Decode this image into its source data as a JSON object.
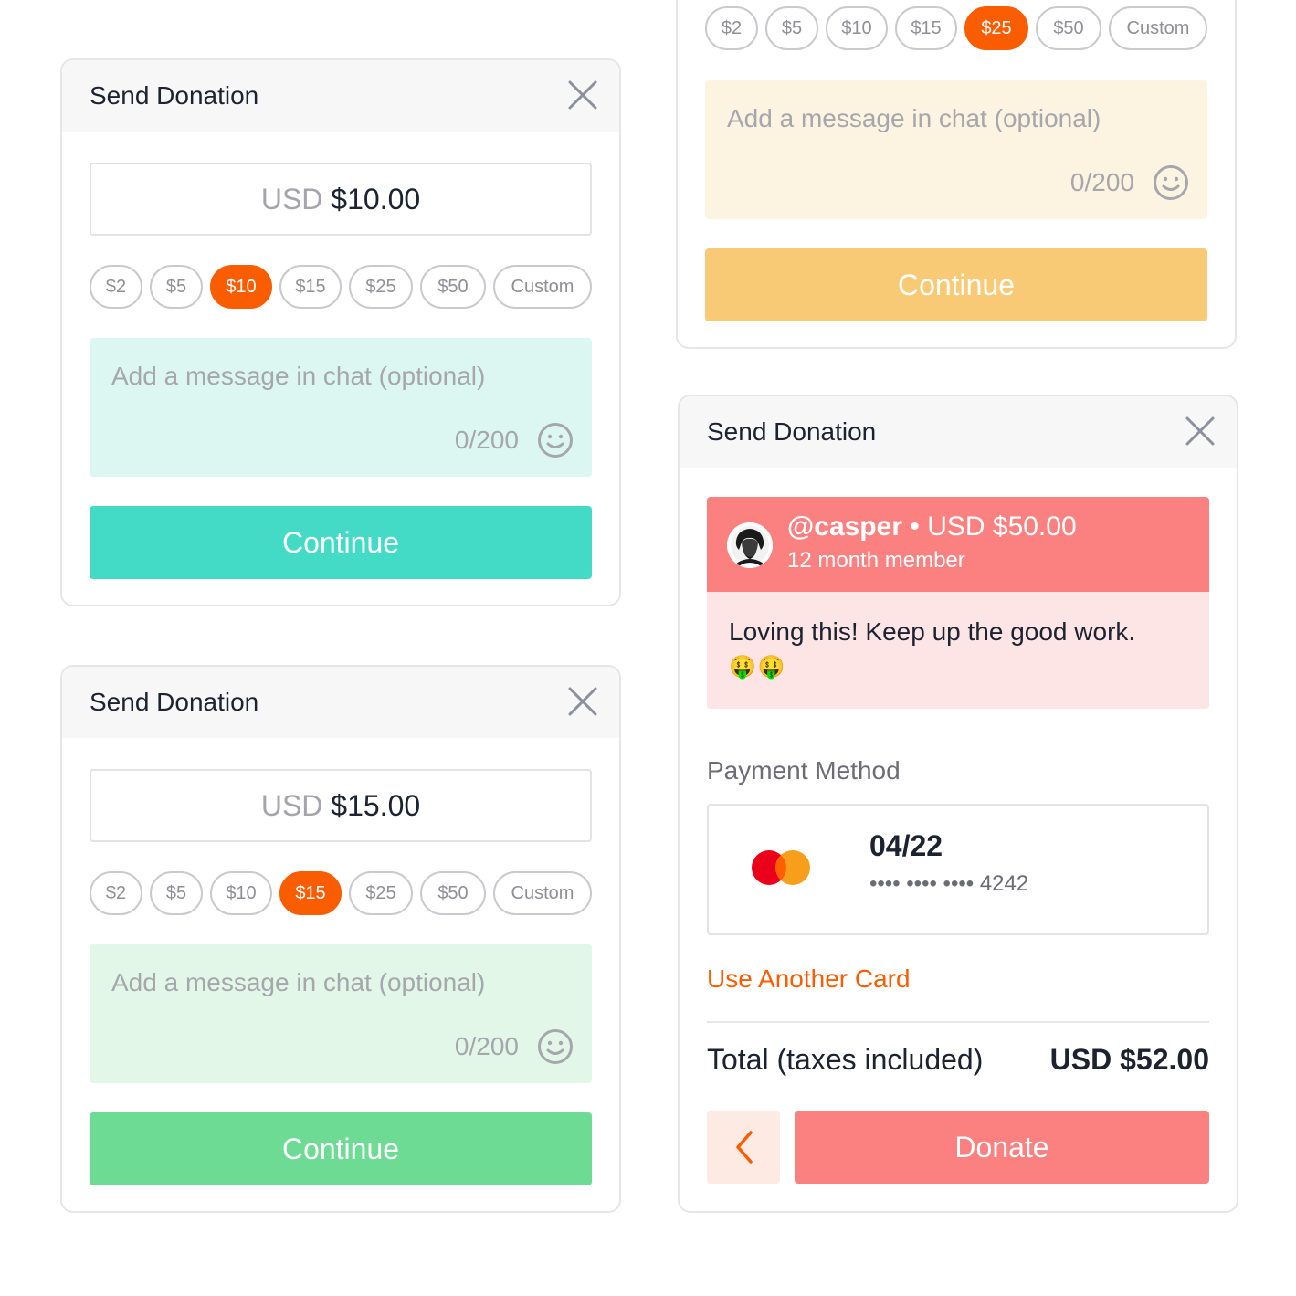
{
  "cards": [
    {
      "title": "Send Donation",
      "currency": "USD",
      "amount": "$10.00",
      "chips": [
        "$2",
        "$5",
        "$10",
        "$15",
        "$25",
        "$50",
        "Custom"
      ],
      "selected_chip": "$10",
      "message_placeholder": "Add a message in chat (optional)",
      "char_count": "0/200",
      "continue_label": "Continue",
      "accent_color": "#43dbc5",
      "message_bg": "#dcf7f1"
    },
    {
      "title": "Send Donation",
      "currency": "USD",
      "amount": "$15.00",
      "chips": [
        "$2",
        "$5",
        "$10",
        "$15",
        "$25",
        "$50",
        "Custom"
      ],
      "selected_chip": "$15",
      "message_placeholder": "Add a message in chat (optional)",
      "char_count": "0/200",
      "continue_label": "Continue",
      "accent_color": "#6ddb93",
      "message_bg": "#e2f7e7"
    },
    {
      "chips": [
        "$2",
        "$5",
        "$10",
        "$15",
        "$25",
        "$50",
        "Custom"
      ],
      "selected_chip": "$25",
      "message_placeholder": "Add a message in chat (optional)",
      "char_count": "0/200",
      "continue_label": "Continue",
      "accent_color": "#f9ca76",
      "message_bg": "#fdf3e1"
    }
  ],
  "donate_card": {
    "title": "Send Donation",
    "username": "@casper",
    "separator": "•",
    "amount": "USD $50.00",
    "membership": "12 month member",
    "message": "Loving this! Keep up the good work.",
    "message_emojis": "🤑🤑",
    "payment_label": "Payment Method",
    "card_expiry": "04/22",
    "card_number": "•••• •••• •••• 4242",
    "card_brand_icon": "mastercard-icon",
    "use_another_card": "Use Another Card",
    "total_label": "Total (taxes included)",
    "total_value": "USD $52.00",
    "donate_label": "Donate",
    "accent_color": "#fb8181",
    "link_color": "#fa5c00"
  },
  "colors": {
    "selected_chip": "#fa5c00",
    "header_bg": "#f7f7f8"
  }
}
